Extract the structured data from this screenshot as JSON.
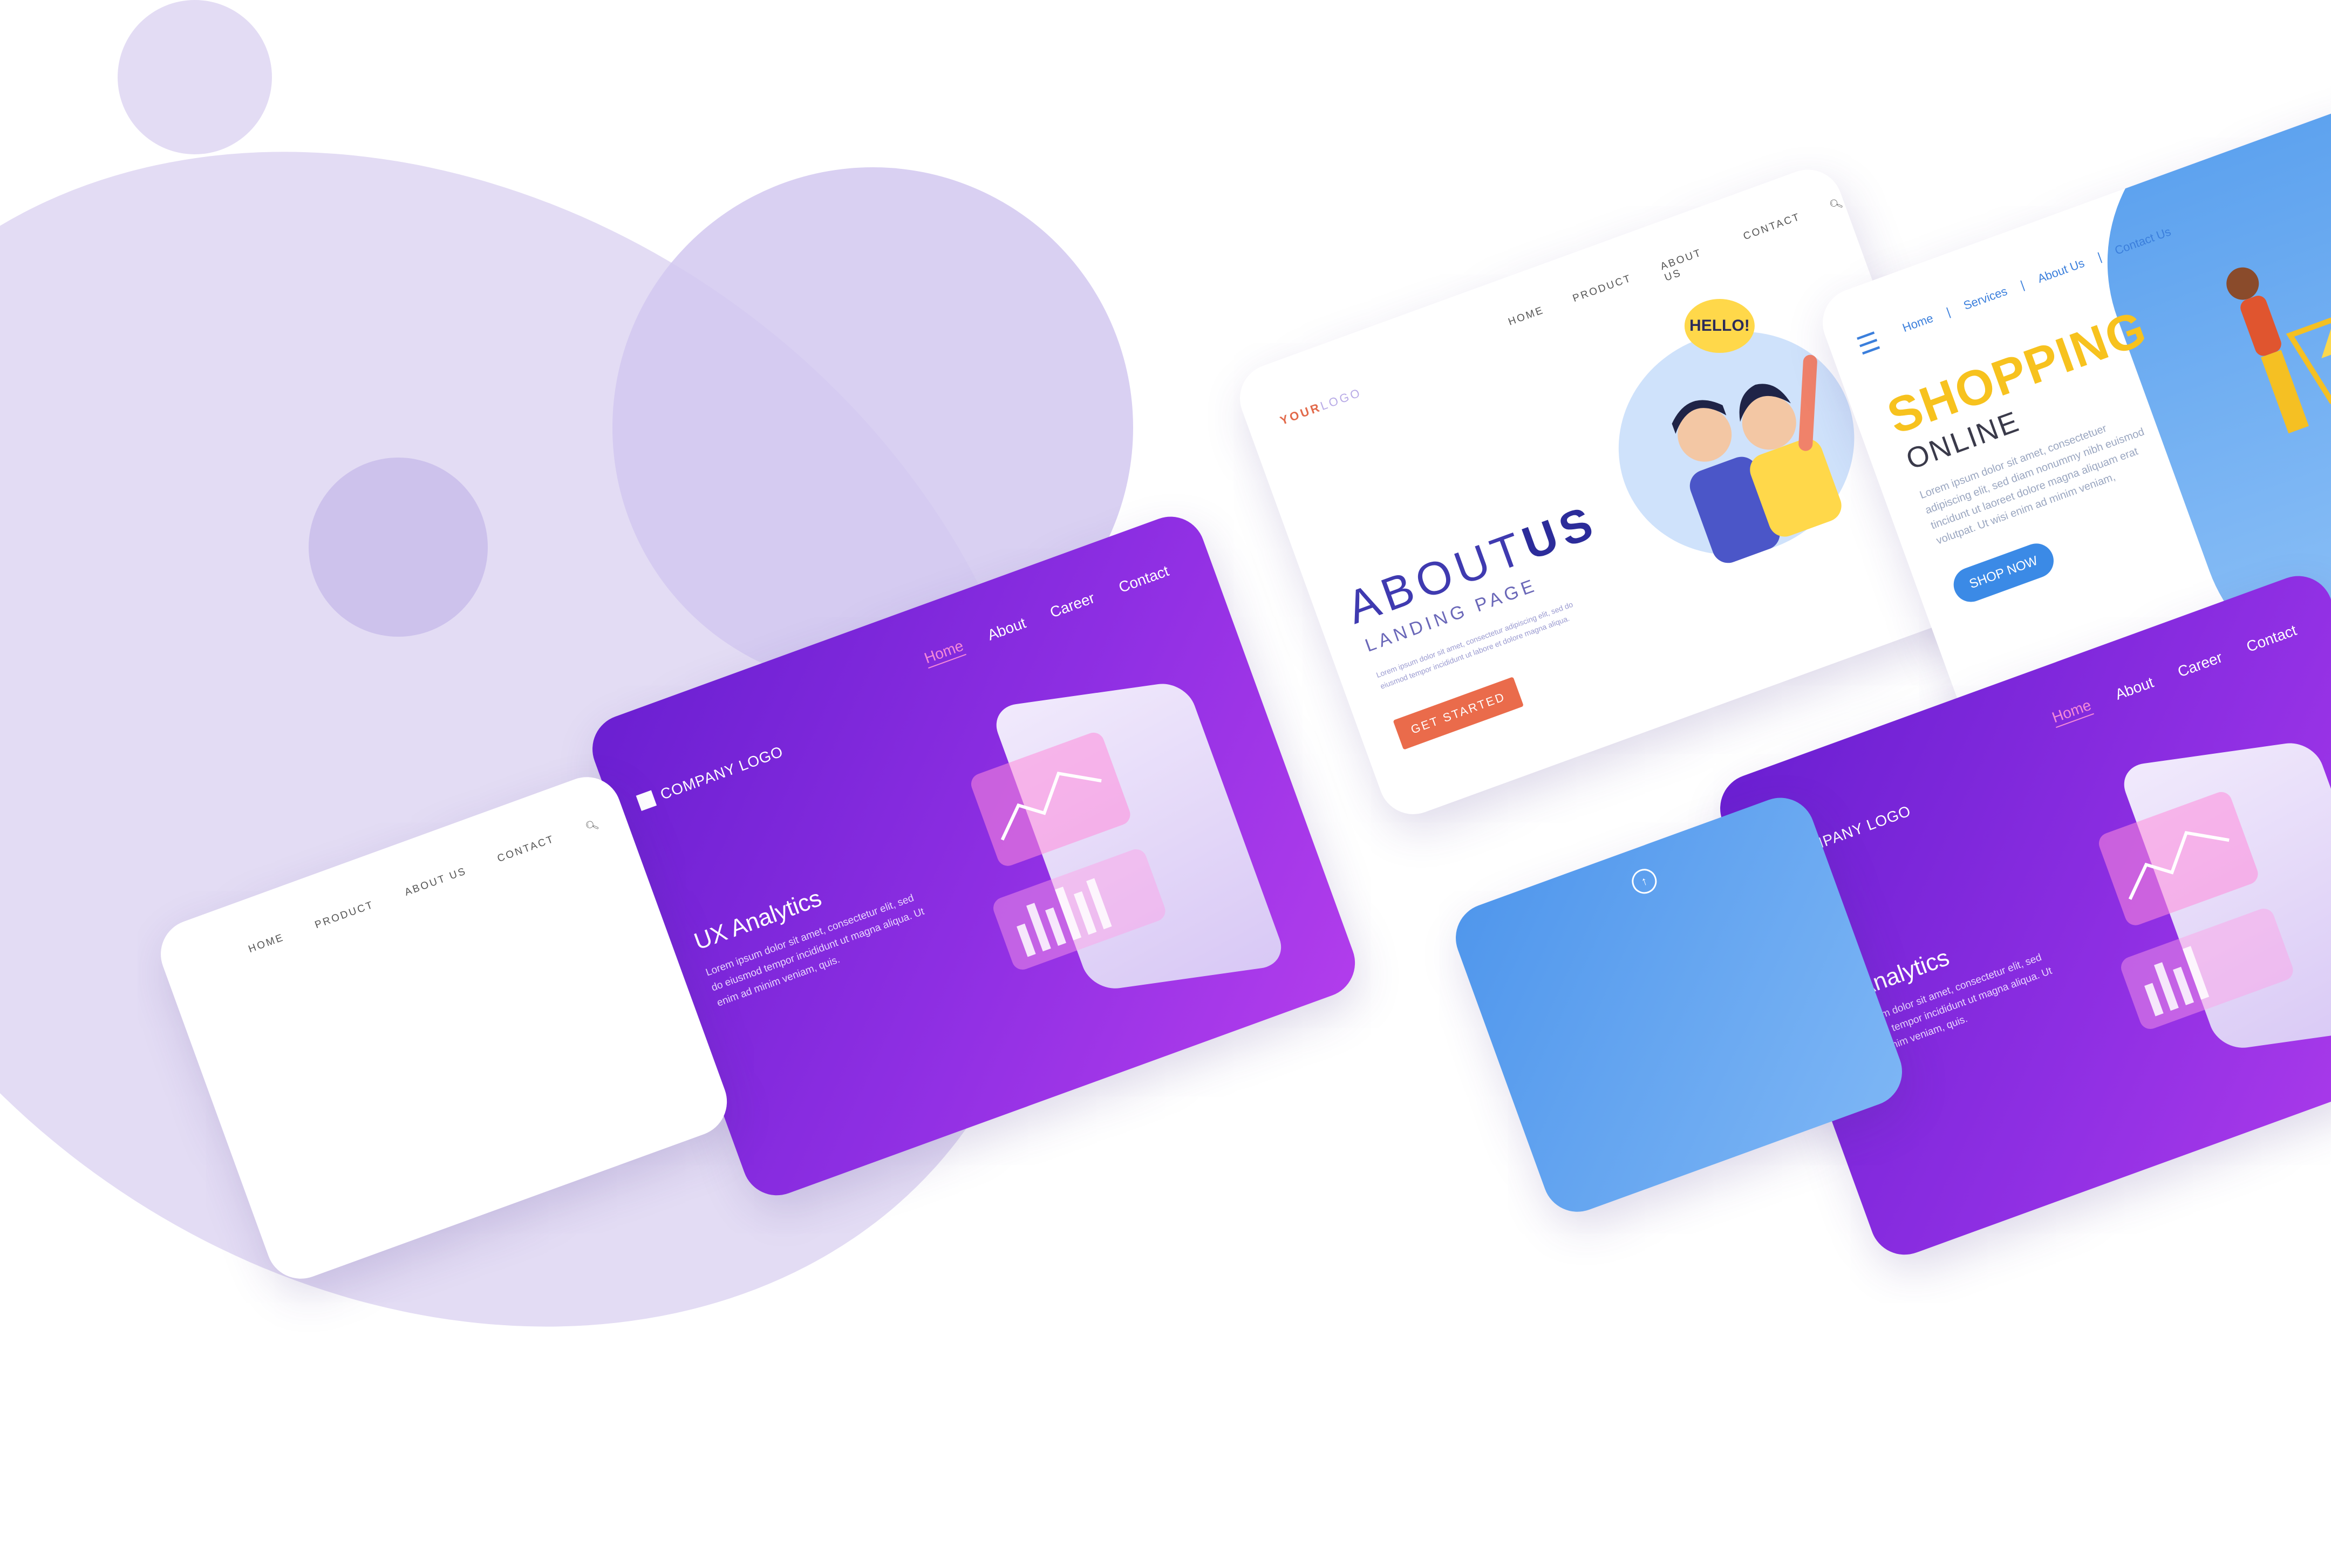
{
  "about_card": {
    "logo_your": "YOUR",
    "logo_logo": "LOGO",
    "nav": [
      "HOME",
      "PRODUCT",
      "ABOUT US",
      "CONTACT"
    ],
    "title_about": "ABOUT",
    "title_us": "US",
    "subtitle": "LANDING PAGE",
    "body": "Lorem ipsum dolor sit amet, consectetur adipiscing elit, sed do eiusmod tempor incididunt ut labore et dolore magna aliqua.",
    "button": "GET STARTED",
    "speech": "HELLO!"
  },
  "shopping_card": {
    "nav": [
      "Home",
      "Services",
      "About Us",
      "Contact Us"
    ],
    "title": "SHOPPING",
    "subtitle": "ONLINE",
    "body": "Lorem ipsum dolor sit amet, consectetuer adipiscing elit, sed diam nonummy nibh euismod tincidunt ut laoreet dolore magna aliquam erat volutpat. Ut wisi enim ad minim veniam,",
    "button": "SHOP NOW"
  },
  "ux_card": {
    "nav": [
      "Home",
      "About",
      "Career",
      "Contact"
    ],
    "logo": "COMPANY LOGO",
    "title": "UX Analytics",
    "body": "Lorem ipsum dolor sit amet, consectetur elit, sed do eiusmod tempor incididunt ut magna aliqua. Ut enim ad minim veniam, quis."
  },
  "bottom_white_card": {
    "nav": [
      "HOME",
      "PRODUCT",
      "ABOUT US",
      "CONTACT"
    ]
  },
  "colors": {
    "lavender_light": "#e3dcf4",
    "lavender_mid": "#cdc2ec",
    "purple_start": "#6a1fd1",
    "purple_end": "#b23dec",
    "orange": "#ea6b4b",
    "yellow": "#f7c21e",
    "blue": "#3b8ae6"
  }
}
